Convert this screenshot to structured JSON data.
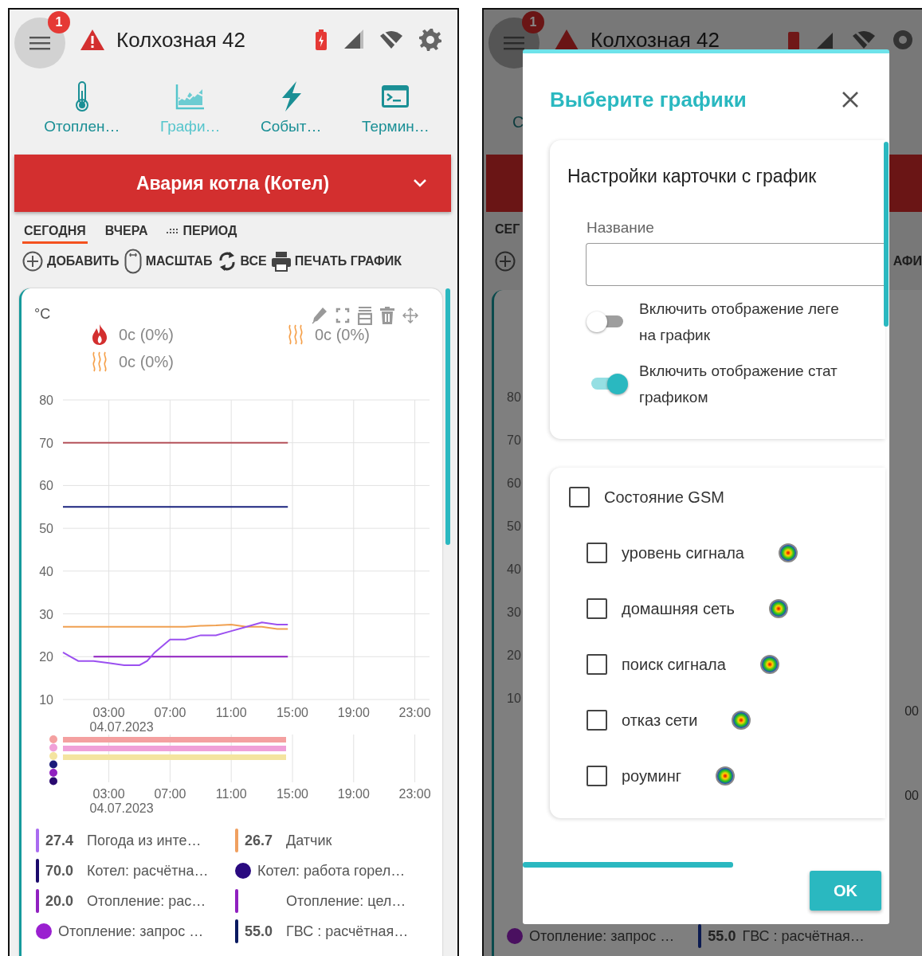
{
  "header": {
    "badge": "1",
    "title": "Колхозная 42"
  },
  "nav": [
    {
      "kind": "heating",
      "label": "Отоплен…",
      "selected": false
    },
    {
      "kind": "charts",
      "label": "Графи…",
      "selected": true
    },
    {
      "kind": "events",
      "label": "Событ…",
      "selected": false
    },
    {
      "kind": "terminal",
      "label": "Термин…",
      "selected": false
    }
  ],
  "alarm": {
    "text": "Авария котла (Котел)"
  },
  "period_tabs": [
    {
      "kind": "day",
      "label": "СЕГОДНЯ",
      "selected": true
    },
    {
      "kind": "day",
      "label": "ВЧЕРА",
      "selected": false
    },
    {
      "kind": "range",
      "label": "ПЕРИОД",
      "selected": false
    }
  ],
  "actions": [
    {
      "kind": "add",
      "label": "ДОБАВИТЬ"
    },
    {
      "kind": "scale",
      "label": "МАСШТАБ"
    },
    {
      "kind": "all",
      "label": "ВСЕ"
    },
    {
      "kind": "print",
      "label": "ПЕЧАТЬ ГРАФИК"
    }
  ],
  "chart_card": {
    "unit": "°C",
    "stats": [
      {
        "kind": "flame",
        "text": "0c (0%)"
      },
      {
        "kind": "heat",
        "text": "0c (0%)"
      },
      {
        "kind": "heat",
        "text": "0c (0%)"
      }
    ],
    "chart_data": {
      "type": "line",
      "grid": true,
      "x": [
        0,
        0.5,
        1,
        2,
        3,
        4,
        5,
        5.5,
        6,
        7,
        8,
        9,
        10,
        11,
        12,
        13,
        14,
        14.7
      ],
      "ylim": [
        10,
        80
      ],
      "xlim": [
        0,
        24
      ],
      "yticks": [
        10,
        20,
        30,
        40,
        50,
        60,
        70,
        80
      ],
      "xticks": [
        {
          "value": 3,
          "label": "03:00"
        },
        {
          "value": 7,
          "label": "07:00"
        },
        {
          "value": 11,
          "label": "11:00"
        },
        {
          "value": 15,
          "label": "15:00"
        },
        {
          "value": 19,
          "label": "19:00"
        },
        {
          "value": 23,
          "label": "23:00"
        }
      ],
      "series": [
        {
          "color": "#b5525a",
          "values": [
            70,
            70,
            70,
            70,
            70,
            70,
            70,
            70,
            70,
            70,
            70,
            70,
            70,
            70,
            70,
            70,
            70,
            70
          ]
        },
        {
          "color": "#1a237e",
          "values": [
            55,
            55,
            55,
            55,
            55,
            55,
            55,
            55,
            55,
            55,
            55,
            55,
            55,
            55,
            55,
            55,
            55,
            55
          ]
        },
        {
          "color": "#f0a050",
          "values": [
            27,
            27,
            27,
            27,
            27,
            27,
            27,
            27,
            27,
            27,
            27,
            27.2,
            27.3,
            27.5,
            27,
            27,
            26.5,
            26.5
          ]
        },
        {
          "color": "#9020c0",
          "values": [
            null,
            null,
            null,
            20,
            20,
            20,
            20,
            20,
            20,
            20,
            20,
            20,
            20,
            20,
            20,
            20,
            20,
            20
          ]
        },
        {
          "color": "#9b50f0",
          "values": [
            21,
            20,
            19,
            19,
            18.5,
            18,
            18,
            19,
            21,
            24,
            24,
            25,
            25,
            26,
            27,
            28,
            27.5,
            27.5
          ]
        }
      ]
    },
    "date_label": "04.07.2023",
    "status_timeline": {
      "dots": [
        {
          "color": "#f4a0a0"
        },
        {
          "color": "#f0a0d8"
        },
        {
          "color": "#f4e4a0"
        },
        {
          "color": "#1a1a7a"
        },
        {
          "color": "#9020c0"
        },
        {
          "color": "#2a0a70"
        }
      ],
      "bands": [
        {
          "color": "#f4a0a0"
        },
        {
          "color": "#f0a0d8"
        },
        {
          "color": "#f4e4a0"
        }
      ],
      "ticks": [
        "03:00",
        "07:00",
        "11:00",
        "15:00",
        "19:00",
        "23:00"
      ],
      "date_label": "04.07.2023"
    },
    "legend": [
      {
        "kind": "bar",
        "color": "#a96bf0",
        "value": "27.4",
        "label": "Погода из инте…"
      },
      {
        "kind": "bar",
        "color": "#f0a060",
        "value": "26.7",
        "label": "Датчик"
      },
      {
        "kind": "bar",
        "color": "#1a0a6b",
        "value": "70.0",
        "label": "Котел: расчётна…"
      },
      {
        "kind": "dot",
        "color": "#2a0a80",
        "label": "Котел: работа горел…"
      },
      {
        "kind": "bar",
        "color": "#9020c0",
        "value": "20.0",
        "label": "Отопление: рас…"
      },
      {
        "kind": "bar",
        "color": "#9020c0",
        "label": "Отопление: цел…"
      },
      {
        "kind": "dot",
        "color": "#9a20d0",
        "label": "Отопление: запрос …"
      },
      {
        "kind": "bar",
        "color": "#0a1a60",
        "value": "55.0",
        "label": "ГВС : расчётная…"
      }
    ]
  },
  "background_screen": {
    "header": {
      "badge": "1",
      "title": "Колхозная 42"
    },
    "nav_fragment": "С",
    "tab_fragment": "СЕГ",
    "action_fragment": "АФИ",
    "y_ticks": [
      "80",
      "70",
      "60",
      "50",
      "40",
      "30",
      "20",
      "10"
    ],
    "x_fragments": [
      "00",
      "00"
    ],
    "legend_row": [
      {
        "kind": "dot",
        "color": "#4a1060",
        "label": "Отопление: запрос …"
      },
      {
        "kind": "bar",
        "color": "#0a1a50",
        "value": "55.0",
        "label": "ГВС : расчётная…"
      }
    ]
  },
  "dialog": {
    "title": "Выберите графики",
    "settings": {
      "heading": "Настройки карточки с график",
      "name_label": "Название",
      "toggles": [
        {
          "lines": [
            "Включить отображение леге",
            "на график"
          ],
          "on": false
        },
        {
          "lines": [
            "Включить отображение стат",
            "графиком"
          ],
          "on": true
        }
      ]
    },
    "groups": [
      {
        "label": "Состояние GSM",
        "checked": false,
        "children": [
          {
            "label": "уровень сигнала",
            "checked": false
          },
          {
            "label": "домашняя сеть",
            "checked": false
          },
          {
            "label": "поиск сигнала",
            "checked": false
          },
          {
            "label": "отказ сети",
            "checked": false
          },
          {
            "label": "роуминг",
            "checked": false
          }
        ]
      }
    ],
    "ok": "OK"
  }
}
